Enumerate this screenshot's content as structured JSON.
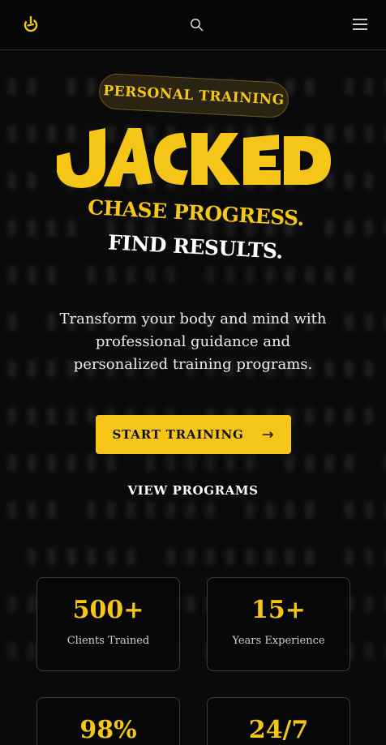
{
  "colors": {
    "accent": "#f5c518",
    "background": "#0a0a0a"
  },
  "header": {
    "logo_icon": "power-logo-icon",
    "search_icon": "search-icon",
    "menu_icon": "hamburger-menu-icon"
  },
  "hero": {
    "badge": "PERSONAL TRAINING",
    "brand": "JACKED",
    "headline_1": "CHASE PROGRESS.",
    "headline_2": "FIND RESULTS.",
    "description": "Transform your body and mind with professional guidance and personalized training programs.",
    "cta_label": "START TRAINING",
    "cta_icon": "arrow-right-icon",
    "secondary_label": "VIEW PROGRAMS"
  },
  "stats": [
    {
      "value": "500+",
      "label": "Clients Trained"
    },
    {
      "value": "15+",
      "label": "Years Experience"
    },
    {
      "value": "98%",
      "label": ""
    },
    {
      "value": "24/7",
      "label": ""
    }
  ]
}
